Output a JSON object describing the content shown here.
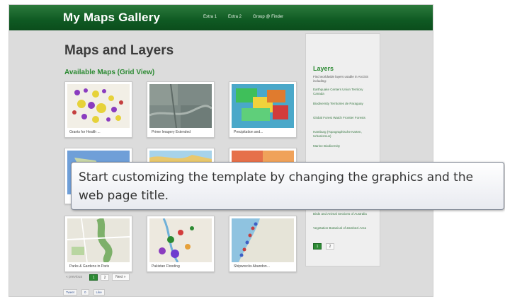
{
  "header": {
    "app_title": "My Maps Gallery",
    "nav": [
      "Extra 1",
      "Extra 2",
      "Group @ Finder"
    ]
  },
  "main": {
    "page_title": "Maps and Layers",
    "section_title": "Available Maps (Grid View)",
    "tiles": [
      {
        "caption": "Grants for Health ..."
      },
      {
        "caption": "Prime Imagery Extended"
      },
      {
        "caption": "Precipitation and..."
      },
      {
        "caption": ""
      },
      {
        "caption": ""
      },
      {
        "caption": ""
      },
      {
        "caption": "Parks & Gardens in Paris"
      },
      {
        "caption": "Pakistan Flooding"
      },
      {
        "caption": "Shipwrecks Abandon..."
      }
    ]
  },
  "sidebar": {
    "title": "Layers",
    "intro": "Find worldwide layers usable in ArcGIS including:",
    "links": [
      "Earthquake Centers Union Territory Canada",
      "Biodiversity Territories de Paraguay",
      "Global Forest Watch Frontier Forests",
      "Hamburg (Topographische Karten, Urbanismus)",
      "Marine Biodiversity",
      "Birds and Animal Sections of Australia",
      "Vegetation Botanical of Zambezi Area"
    ],
    "pager": [
      "1",
      "2"
    ]
  },
  "pager": {
    "prev": "« previous",
    "pages": [
      "1",
      "2"
    ],
    "next": "Next »"
  },
  "social": {
    "tweet": "Tweet",
    "count": "0",
    "like": "Like"
  },
  "tooltip": {
    "text": "Start customizing the template by changing the graphics and the web page title."
  }
}
